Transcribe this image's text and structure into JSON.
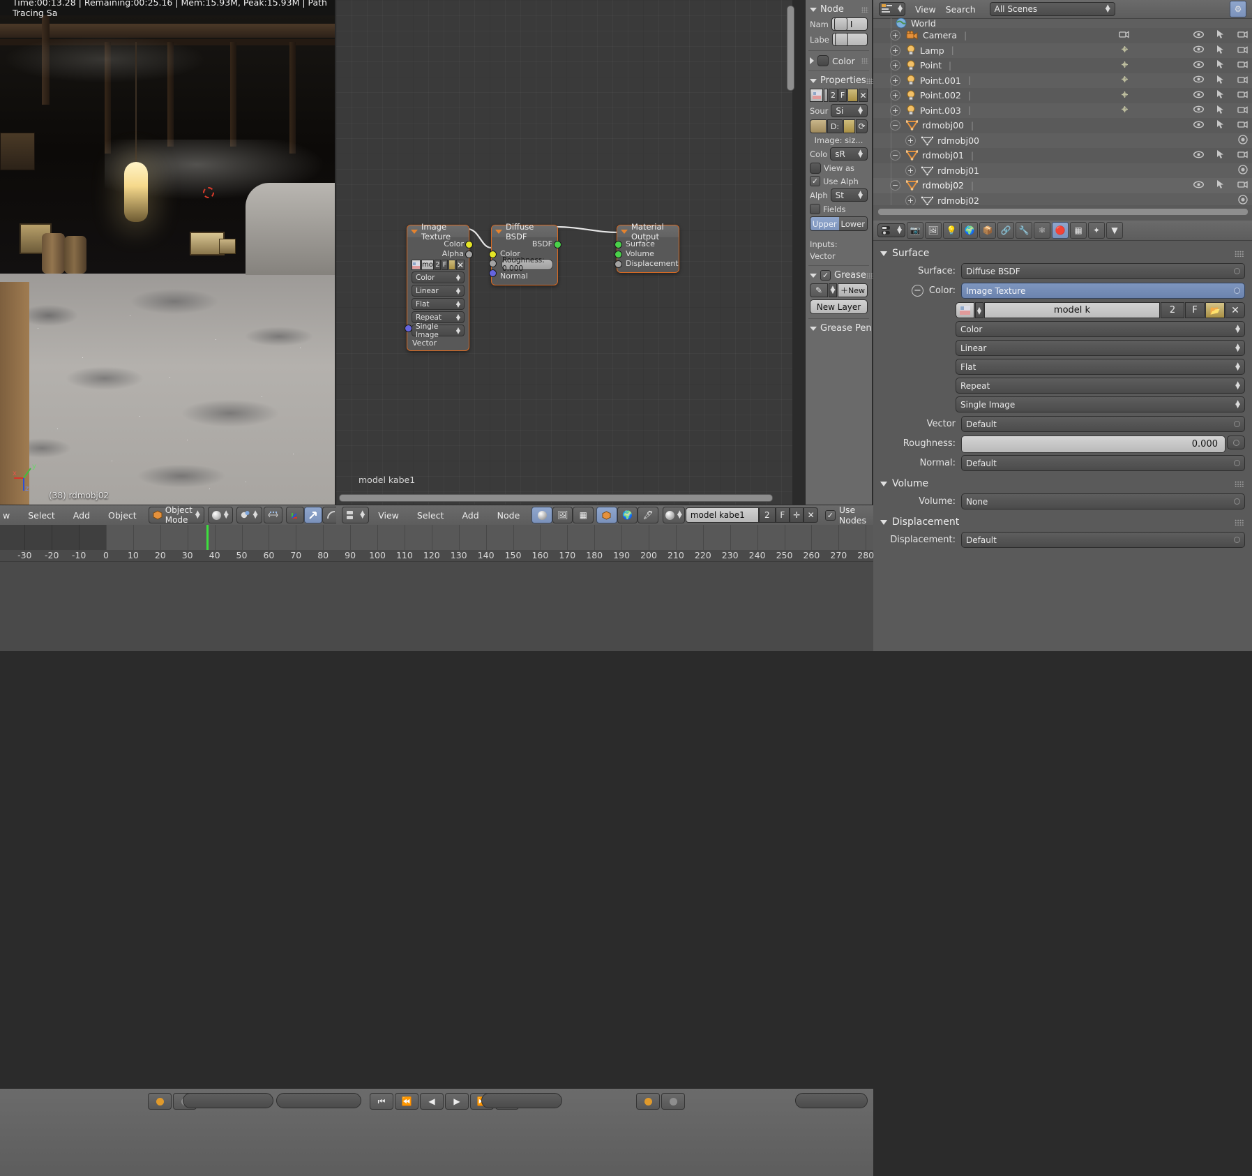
{
  "viewport": {
    "render_stats": "Time:00:13.28 | Remaining:00:25.16 | Mem:15.93M, Peak:15.93M | Path Tracing Sa",
    "object_info": "(38) rdmobj02",
    "axis": {
      "x": "x",
      "y": "y",
      "z": "z"
    }
  },
  "node_editor": {
    "label": "model kabe1",
    "nodes": [
      {
        "title": "Image Texture",
        "outputs": [
          "Color",
          "Alpha"
        ],
        "image_widget": {
          "name": "mo",
          "users": "2",
          "fake": "F"
        },
        "dropdowns": [
          "Color",
          "Linear",
          "Flat",
          "Repeat",
          "Single Image"
        ],
        "inputs": [
          "Vector"
        ]
      },
      {
        "title": "Diffuse BSDF",
        "outputs": [
          "BSDF"
        ],
        "inputs": [
          "Color",
          "Normal"
        ],
        "roughness": "Roughness: 0.000"
      },
      {
        "title": "Material Output",
        "inputs": [
          "Surface",
          "Volume",
          "Displacement"
        ]
      }
    ]
  },
  "npanel": {
    "node_section": "Node",
    "name_label": "Nam",
    "label_label": "Labe",
    "color_section": "Color",
    "properties_section": "Properties",
    "image_users": "2",
    "image_fake": "F",
    "source_label": "Sour",
    "source_value": "Si",
    "datablock_label": "D:",
    "image_size": "Image: siz...",
    "color_label": "Colo",
    "color_value": "sR",
    "view_as": "View as",
    "use_alpha": "Use Alph",
    "alpha_label": "Alph",
    "alpha_value": "St",
    "fields": "Fields",
    "field_upper": "Upper",
    "field_lower": "Lower",
    "inputs_label": "Inputs:",
    "vector_label": "Vector",
    "grease_section": "Grease",
    "new_button": "New",
    "new_layer_button": "New Layer",
    "grease_pencil_section": "Grease Pen"
  },
  "outliner": {
    "menus": [
      "View",
      "Search"
    ],
    "scene_selector": "All Scenes",
    "rows": [
      {
        "name": "World",
        "icon": "world-icon",
        "indent": 0,
        "expander": "none",
        "partial": true
      },
      {
        "name": "Camera",
        "icon": "camera-icon",
        "indent": 0,
        "expander": "plus"
      },
      {
        "name": "Lamp",
        "icon": "lamp-icon",
        "indent": 0,
        "expander": "plus"
      },
      {
        "name": "Point",
        "icon": "lamp-icon",
        "indent": 0,
        "expander": "plus"
      },
      {
        "name": "Point.001",
        "icon": "lamp-icon",
        "indent": 0,
        "expander": "plus"
      },
      {
        "name": "Point.002",
        "icon": "lamp-icon",
        "indent": 0,
        "expander": "plus"
      },
      {
        "name": "Point.003",
        "icon": "lamp-icon",
        "indent": 0,
        "expander": "plus"
      },
      {
        "name": "rdmobj00",
        "icon": "mesh-object-icon",
        "indent": 0,
        "expander": "minus"
      },
      {
        "name": "rdmobj00",
        "icon": "mesh-data-icon",
        "indent": 1,
        "expander": "plus"
      },
      {
        "name": "rdmobj01",
        "icon": "mesh-object-icon",
        "indent": 0,
        "expander": "minus"
      },
      {
        "name": "rdmobj01",
        "icon": "mesh-data-icon",
        "indent": 1,
        "expander": "plus"
      },
      {
        "name": "rdmobj02",
        "icon": "mesh-object-icon",
        "indent": 0,
        "expander": "minus",
        "selected": true
      },
      {
        "name": "rdmobj02",
        "icon": "mesh-data-icon",
        "indent": 1,
        "expander": "plus"
      }
    ]
  },
  "properties": {
    "sections": {
      "surface": "Surface",
      "volume": "Volume",
      "displacement": "Displacement"
    },
    "surface_label": "Surface:",
    "surface_value": "Diffuse BSDF",
    "color_label": "Color:",
    "color_value": "Image Texture",
    "image_name": "model  k",
    "image_users": "2",
    "image_fake": "F",
    "dropdowns": [
      "Color",
      "Linear",
      "Flat",
      "Repeat",
      "Single Image"
    ],
    "vector_label": "Vector",
    "vector_value": "Default",
    "roughness_label": "Roughness:",
    "roughness_value": "0.000",
    "normal_label": "Normal:",
    "normal_value": "Default",
    "volume_label": "Volume:",
    "volume_value": "None",
    "displacement_label": "Displacement:",
    "displacement_value": "Default"
  },
  "viewport_bar": {
    "menus": [
      "w",
      "Select",
      "Add",
      "Object"
    ],
    "mode": "Object Mode"
  },
  "node_bar": {
    "menus": [
      "View",
      "Select",
      "Add",
      "Node"
    ],
    "material_name": "model kabe1",
    "users": "2",
    "fake": "F",
    "use_nodes": "Use Nodes"
  },
  "timeline": {
    "ticks": [
      "-30",
      "-20",
      "-10",
      "0",
      "10",
      "20",
      "30",
      "40",
      "50",
      "60",
      "70",
      "80",
      "90",
      "100",
      "110",
      "120",
      "130",
      "140",
      "150",
      "160",
      "170",
      "180",
      "190",
      "200",
      "210",
      "220",
      "230",
      "240",
      "250",
      "260",
      "270",
      "280"
    ],
    "playhead": "38"
  }
}
